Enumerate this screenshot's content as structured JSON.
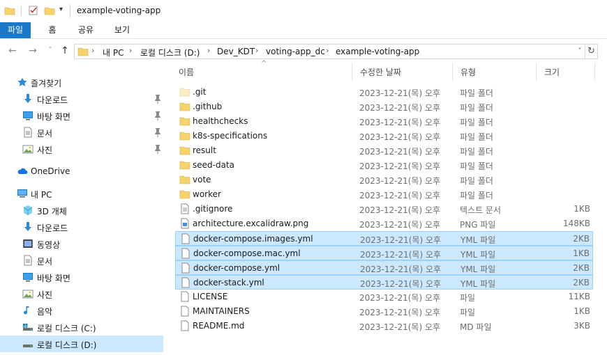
{
  "window": {
    "title": "example-voting-app"
  },
  "ribbon": {
    "tabs": [
      "파일",
      "홈",
      "공유",
      "보기"
    ]
  },
  "address": {
    "crumbs": [
      "내 PC",
      "로컬 디스크 (D:)",
      "Dev_KDT",
      "voting-app_dc",
      "example-voting-app"
    ]
  },
  "nav": {
    "quick_access": "즐겨찾기",
    "quick_items": [
      {
        "label": "다운로드",
        "icon": "download-arrow-icon",
        "pinned": true
      },
      {
        "label": "바탕 화면",
        "icon": "desktop-icon",
        "pinned": true
      },
      {
        "label": "문서",
        "icon": "document-icon",
        "pinned": true
      },
      {
        "label": "사진",
        "icon": "pictures-icon",
        "pinned": true
      }
    ],
    "onedrive": "OneDrive",
    "this_pc": "내 PC",
    "pc_items": [
      {
        "label": "3D 개체",
        "icon": "3d-objects-icon"
      },
      {
        "label": "다운로드",
        "icon": "download-arrow-icon"
      },
      {
        "label": "동영상",
        "icon": "videos-icon"
      },
      {
        "label": "문서",
        "icon": "document-icon"
      },
      {
        "label": "바탕 화면",
        "icon": "desktop-icon"
      },
      {
        "label": "사진",
        "icon": "pictures-icon"
      },
      {
        "label": "음악",
        "icon": "music-icon"
      },
      {
        "label": "로컬 디스크 (C:)",
        "icon": "drive-c-icon"
      },
      {
        "label": "로컬 디스크 (D:)",
        "icon": "drive-icon",
        "selected": true
      }
    ]
  },
  "columns": {
    "name": "이름",
    "date": "수정한 날짜",
    "type": "유형",
    "size": "크기"
  },
  "files": [
    {
      "name": ".git",
      "date": "2023-12-21(목) 오후 ...",
      "type": "파일 폴더",
      "size": "",
      "kind": "folder-hidden",
      "selected": false
    },
    {
      "name": ".github",
      "date": "2023-12-21(목) 오후 ...",
      "type": "파일 폴더",
      "size": "",
      "kind": "folder",
      "selected": false
    },
    {
      "name": "healthchecks",
      "date": "2023-12-21(목) 오후 ...",
      "type": "파일 폴더",
      "size": "",
      "kind": "folder",
      "selected": false
    },
    {
      "name": "k8s-specifications",
      "date": "2023-12-21(목) 오후 ...",
      "type": "파일 폴더",
      "size": "",
      "kind": "folder",
      "selected": false
    },
    {
      "name": "result",
      "date": "2023-12-21(목) 오후 ...",
      "type": "파일 폴더",
      "size": "",
      "kind": "folder",
      "selected": false
    },
    {
      "name": "seed-data",
      "date": "2023-12-21(목) 오후 ...",
      "type": "파일 폴더",
      "size": "",
      "kind": "folder",
      "selected": false
    },
    {
      "name": "vote",
      "date": "2023-12-21(목) 오후 ...",
      "type": "파일 폴더",
      "size": "",
      "kind": "folder",
      "selected": false
    },
    {
      "name": "worker",
      "date": "2023-12-21(목) 오후 ...",
      "type": "파일 폴더",
      "size": "",
      "kind": "folder",
      "selected": false
    },
    {
      "name": ".gitignore",
      "date": "2023-12-21(목) 오후 ...",
      "type": "텍스트 문서",
      "size": "1KB",
      "kind": "text",
      "selected": false
    },
    {
      "name": "architecture.excalidraw.png",
      "date": "2023-12-21(목) 오후 ...",
      "type": "PNG 파일",
      "size": "148KB",
      "kind": "image",
      "selected": false
    },
    {
      "name": "docker-compose.images.yml",
      "date": "2023-12-21(목) 오후 ...",
      "type": "YML 파일",
      "size": "2KB",
      "kind": "file",
      "selected": true
    },
    {
      "name": "docker-compose.mac.yml",
      "date": "2023-12-21(목) 오후 ...",
      "type": "YML 파일",
      "size": "1KB",
      "kind": "file",
      "selected": true
    },
    {
      "name": "docker-compose.yml",
      "date": "2023-12-21(목) 오후 ...",
      "type": "YML 파일",
      "size": "2KB",
      "kind": "file",
      "selected": true
    },
    {
      "name": "docker-stack.yml",
      "date": "2023-12-21(목) 오후 ...",
      "type": "YML 파일",
      "size": "2KB",
      "kind": "file",
      "selected": true
    },
    {
      "name": "LICENSE",
      "date": "2023-12-21(목) 오후 ...",
      "type": "파일",
      "size": "11KB",
      "kind": "file",
      "selected": false
    },
    {
      "name": "MAINTAINERS",
      "date": "2023-12-21(목) 오후 ...",
      "type": "파일",
      "size": "1KB",
      "kind": "file",
      "selected": false
    },
    {
      "name": "README.md",
      "date": "2023-12-21(목) 오후 ...",
      "type": "MD 파일",
      "size": "3KB",
      "kind": "file",
      "selected": false
    }
  ],
  "colors": {
    "accent": "#1979ca",
    "selection": "#cce8ff",
    "selection_border": "#99d1ff",
    "folder": "#f6d36b"
  }
}
